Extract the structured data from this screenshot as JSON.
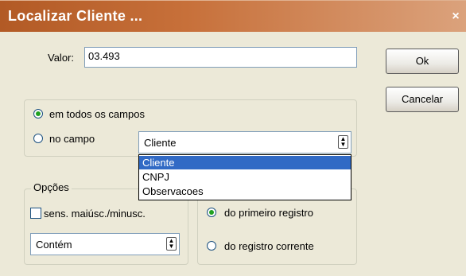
{
  "window": {
    "title": "Localizar Cliente ...",
    "close_glyph": "×"
  },
  "valor": {
    "label": "Valor:",
    "value": "03.493"
  },
  "buttons": {
    "ok": "Ok",
    "cancel": "Cancelar"
  },
  "scope": {
    "all_fields": "em todos os campos",
    "one_field": "no campo",
    "selected": "all_fields",
    "field_combo_value": "Cliente",
    "field_options": [
      "Cliente",
      "CNPJ",
      "Observacoes"
    ],
    "highlighted_option": "Cliente"
  },
  "options_group": {
    "legend": "Opções",
    "case_sensitive": "sens. maiúsc./minusc.",
    "case_sensitive_checked": false,
    "match_mode": "Contém"
  },
  "start_group": {
    "from_first": "do primeiro registro",
    "from_current": "do registro corrente",
    "selected": "from_first"
  },
  "colors": {
    "title_bar": "#b25a25",
    "selection": "#316ac5",
    "dialog_bg": "#ece9d8"
  }
}
